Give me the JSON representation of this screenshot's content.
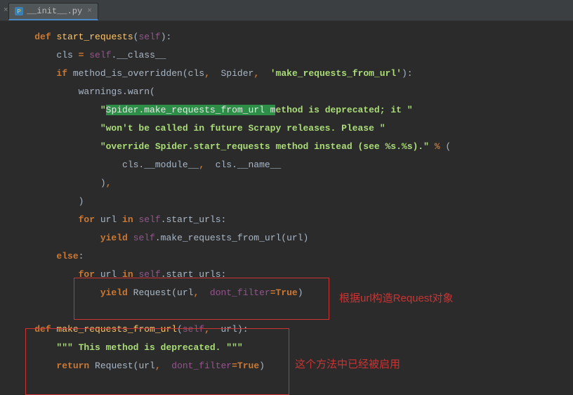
{
  "tab": {
    "filename": "__init__.py",
    "close_glyph": "×",
    "left_close_glyph": "×"
  },
  "code": {
    "l1_def": "def",
    "l1_fn": "start_requests",
    "l1_open": "(",
    "l1_self": "self",
    "l1_close": "):",
    "l2_cls": "cls ",
    "l2_eq": "= ",
    "l2_self": "self",
    "l2_dot": ".__class__",
    "l3_if": "if",
    "l3_call": " method_is_overridden(cls",
    "l3_comma1": ",",
    "l3_sp1": "  Spider",
    "l3_comma2": ",",
    "l3_sp2": "  ",
    "l3_str": "'make_requests_from_url'",
    "l3_close": "):",
    "l4_warn": "warnings.warn(",
    "l5_q": "\"",
    "l5_sel": "Spider.make_requests_from_url m",
    "l5_rest": "ethod is deprecated",
    "l5_semi": "; ",
    "l5_it": "it \"",
    "l6_str": "\"won't be called in future Scrapy releases. Please \"",
    "l7_str": "\"override Spider.start_requests method instead (see %s.%s).\"",
    "l7_pct": " % ",
    "l7_open": "(",
    "l8_body": "cls.__module__",
    "l8_comma": ",",
    "l8_rest": "  cls.__name__",
    "l9_close": ")",
    "l9_comma": ",",
    "l10_close": ")",
    "l11_for": "for",
    "l11_url": " url ",
    "l11_in": "in",
    "l11_sp": " ",
    "l11_self": "self",
    "l11_urls": ".start_urls",
    "l11_colon": ":",
    "l12_yield": "yield",
    "l12_sp": " ",
    "l12_self": "self",
    "l12_call": ".make_requests_from_url(url)",
    "l13_else": "else",
    "l13_colon": ":",
    "l14_for": "for",
    "l14_url": " url ",
    "l14_in": "in",
    "l14_sp": " ",
    "l14_self": "self",
    "l14_urls": ".start_urls",
    "l14_colon": ":",
    "l15_yield": "yield",
    "l15_req": " Request(url",
    "l15_comma": ",",
    "l15_sp": "  ",
    "l15_df": "dont_filter",
    "l15_eq": "=",
    "l15_true": "True",
    "l15_close": ")",
    "l17_def": "def",
    "l17_fn": " make_requests_from_url",
    "l17_open": "(",
    "l17_self": "self",
    "l17_comma": ",",
    "l17_url": "  url):",
    "l18_doc": "\"\"\" This method is deprecated. \"\"\"",
    "l19_ret": "return",
    "l19_req": " Request(url",
    "l19_comma": ",",
    "l19_sp": "  ",
    "l19_df": "dont_filter",
    "l19_eq": "=",
    "l19_true": "True",
    "l19_close": ")"
  },
  "annotations": {
    "a1": "根据url构造Request对象",
    "a2": "这个方法中已经被启用"
  }
}
